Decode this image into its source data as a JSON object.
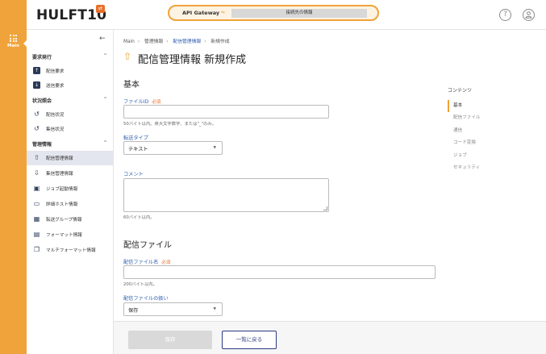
{
  "rail": {
    "main_label": "Main"
  },
  "header": {
    "logo": "HULFT10",
    "logo_badge": "⇄",
    "gateway_label": "API Gateway",
    "gateway_icon": "link-icon",
    "gateway_status": "接続先の情報",
    "help_icon": "?",
    "user_icon": "user-icon"
  },
  "sidebar": {
    "sections": [
      {
        "title": "要求発行",
        "items": [
          {
            "label": "配信要求",
            "icon": "upload-icon"
          },
          {
            "label": "送信要求",
            "icon": "download-icon"
          }
        ]
      },
      {
        "title": "状況照会",
        "items": [
          {
            "label": "配信状況",
            "icon": "history-icon"
          },
          {
            "label": "集信状況",
            "icon": "history-icon"
          }
        ]
      },
      {
        "title": "管理情報",
        "items": [
          {
            "label": "配信管理情報",
            "icon": "upload-tray-icon"
          },
          {
            "label": "集信管理情報",
            "icon": "download-tray-icon"
          },
          {
            "label": "ジョブ起動情報",
            "icon": "job-icon"
          },
          {
            "label": "詳細ホスト情報",
            "icon": "host-icon"
          },
          {
            "label": "転送グループ情報",
            "icon": "group-icon"
          },
          {
            "label": "フォーマット情報",
            "icon": "format-icon"
          },
          {
            "label": "マルチフォーマット情報",
            "icon": "multi-format-icon"
          }
        ]
      }
    ],
    "active_item": "配信管理情報"
  },
  "breadcrumb": [
    "Main",
    "管理情報",
    "配信管理情報",
    "新規作成"
  ],
  "page": {
    "title": "配信管理情報 新規作成",
    "sections": {
      "basic": "基本",
      "file": "配信ファイル"
    },
    "fields": {
      "file_id": {
        "label": "ファイルID",
        "required": "必須",
        "value": "",
        "hint": "50バイト以内。英大文字数字、または\"_\"のみ。"
      },
      "transfer_type": {
        "label": "転送タイプ",
        "value": "テキスト"
      },
      "comment": {
        "label": "コメント",
        "value": "",
        "hint": "60バイト以内。"
      },
      "file_name": {
        "label": "配信ファイル名",
        "required": "必須",
        "value": "",
        "hint": "200バイト以内。"
      },
      "file_handling": {
        "label": "配信ファイルの扱い",
        "value": "保存"
      }
    }
  },
  "toc": {
    "title": "コンテンツ",
    "items": [
      "基本",
      "配信ファイル",
      "通信",
      "コード変換",
      "ジョブ",
      "セキュリティ"
    ],
    "active": "基本"
  },
  "footer": {
    "save_label": "保存",
    "back_label": "一覧に戻る"
  },
  "colors": {
    "accent": "#f0a33a",
    "link": "#2a5db0",
    "nav_dark": "#2b3a57"
  }
}
